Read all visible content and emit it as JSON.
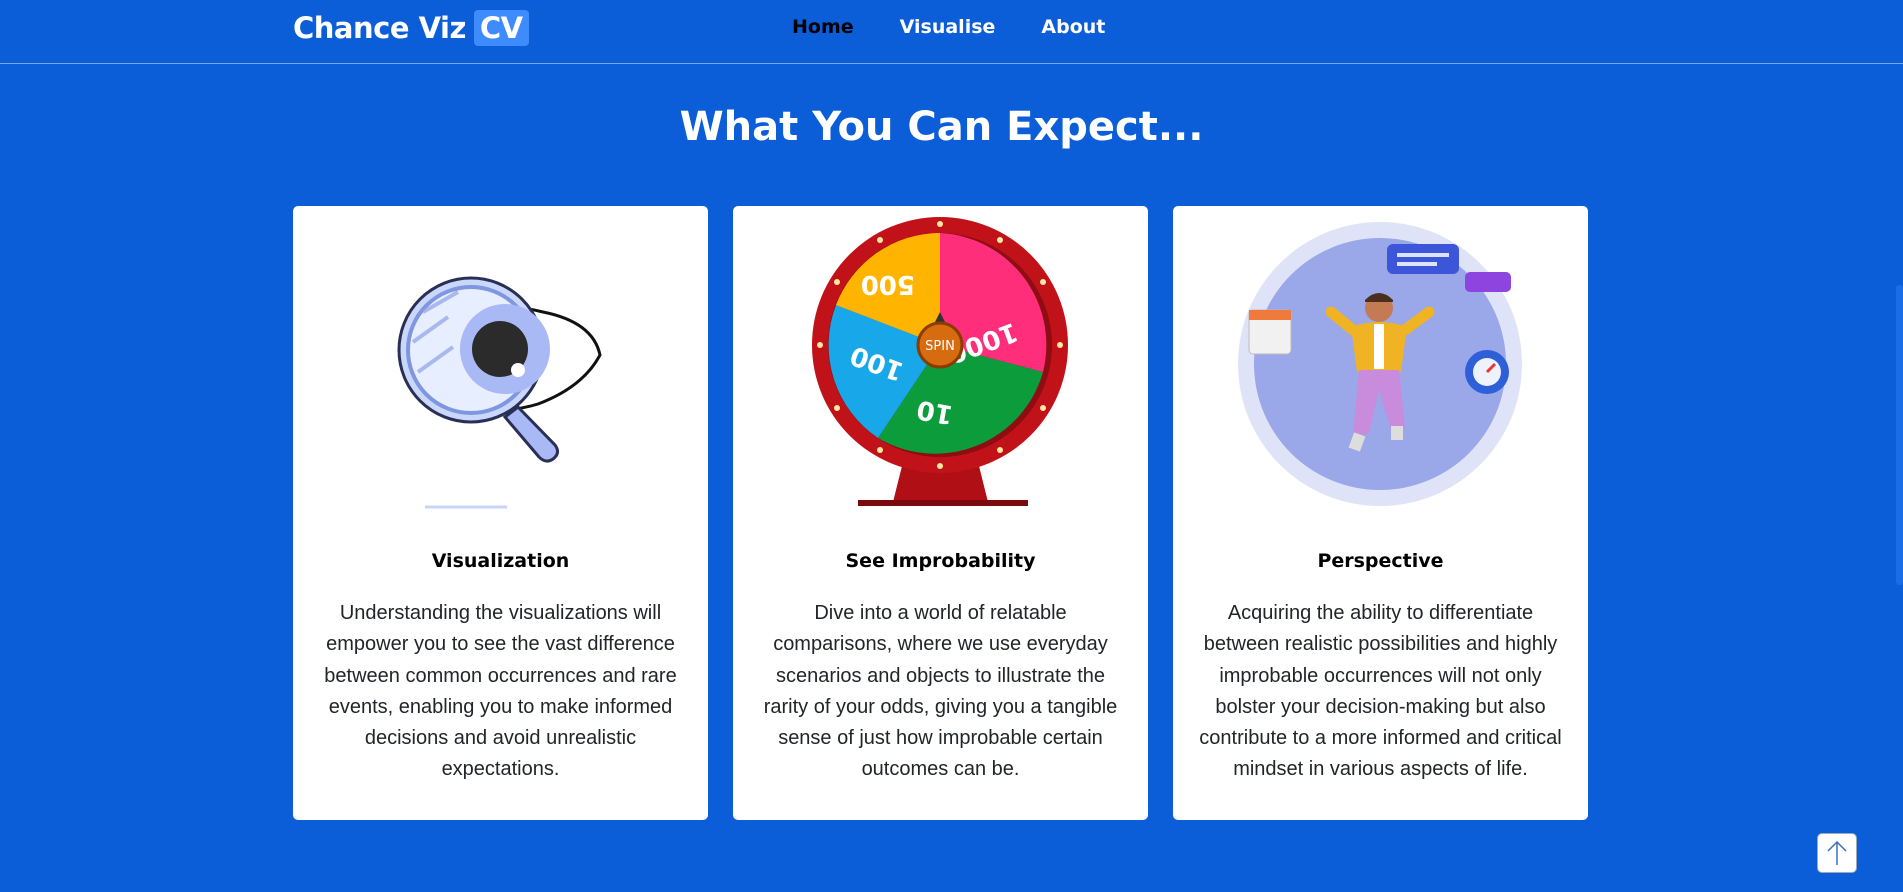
{
  "nav": {
    "brand": "Chance Viz",
    "brand_badge": "CV",
    "links": [
      "Home",
      "Visualise",
      "About"
    ],
    "active": "Home"
  },
  "main": {
    "heading": "What You Can Expect..."
  },
  "cards": [
    {
      "title": "Visualization",
      "text": "Understanding the visualizations will empower you to see the vast difference between common occurrences and rare events, enabling you to make informed decisions and avoid unrealistic expectations.",
      "image": "magnifier-eye-illustration"
    },
    {
      "title": "See Improbability",
      "text": "Dive into a world of relatable comparisons, where we use everyday scenarios and objects to illustrate the rarity of your odds, giving you a tangible sense of just how improbable certain outcomes can be.",
      "image": "prize-wheel-illustration",
      "wheel": {
        "segments": [
          "500",
          "1000",
          "10",
          "100"
        ],
        "center": "SPIN"
      }
    },
    {
      "title": "Perspective",
      "text": "Acquiring the ability to differentiate between realistic possibilities and highly improbable occurrences will not only bolster your decision-making but also contribute to a more informed and critical mindset in various aspects of life.",
      "image": "person-jumping-illustration"
    }
  ],
  "colors": {
    "background": "#0b5ed7",
    "badge": "#3d8bfd",
    "card": "#ffffff"
  },
  "scroll_top_icon": "arrow-up-icon"
}
